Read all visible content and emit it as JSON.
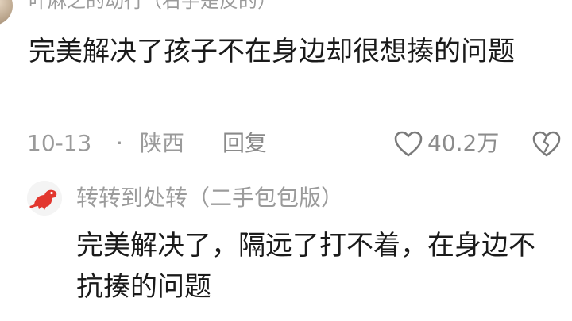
{
  "main_comment": {
    "username": "叶麻之的动行（右手是反的）",
    "content": "完美解决了孩子不在身边却很想揍的问题",
    "date": "10-13",
    "separator": "·",
    "location": "陕西",
    "reply_label": "回复",
    "like_count": "40.2万",
    "like_icon": "heart-outline-icon",
    "dislike_icon": "broken-heart-icon"
  },
  "reply_comment": {
    "username": "转转到处转（二手包包版）",
    "content": "完美解决了，隔远了打不着，在身边不抗揍的问题",
    "avatar_icon": "red-dinosaur-avatar"
  },
  "colors": {
    "text_primary": "#1a1a1a",
    "text_secondary": "#9b9b9b",
    "avatar_red": "#e2372f"
  }
}
